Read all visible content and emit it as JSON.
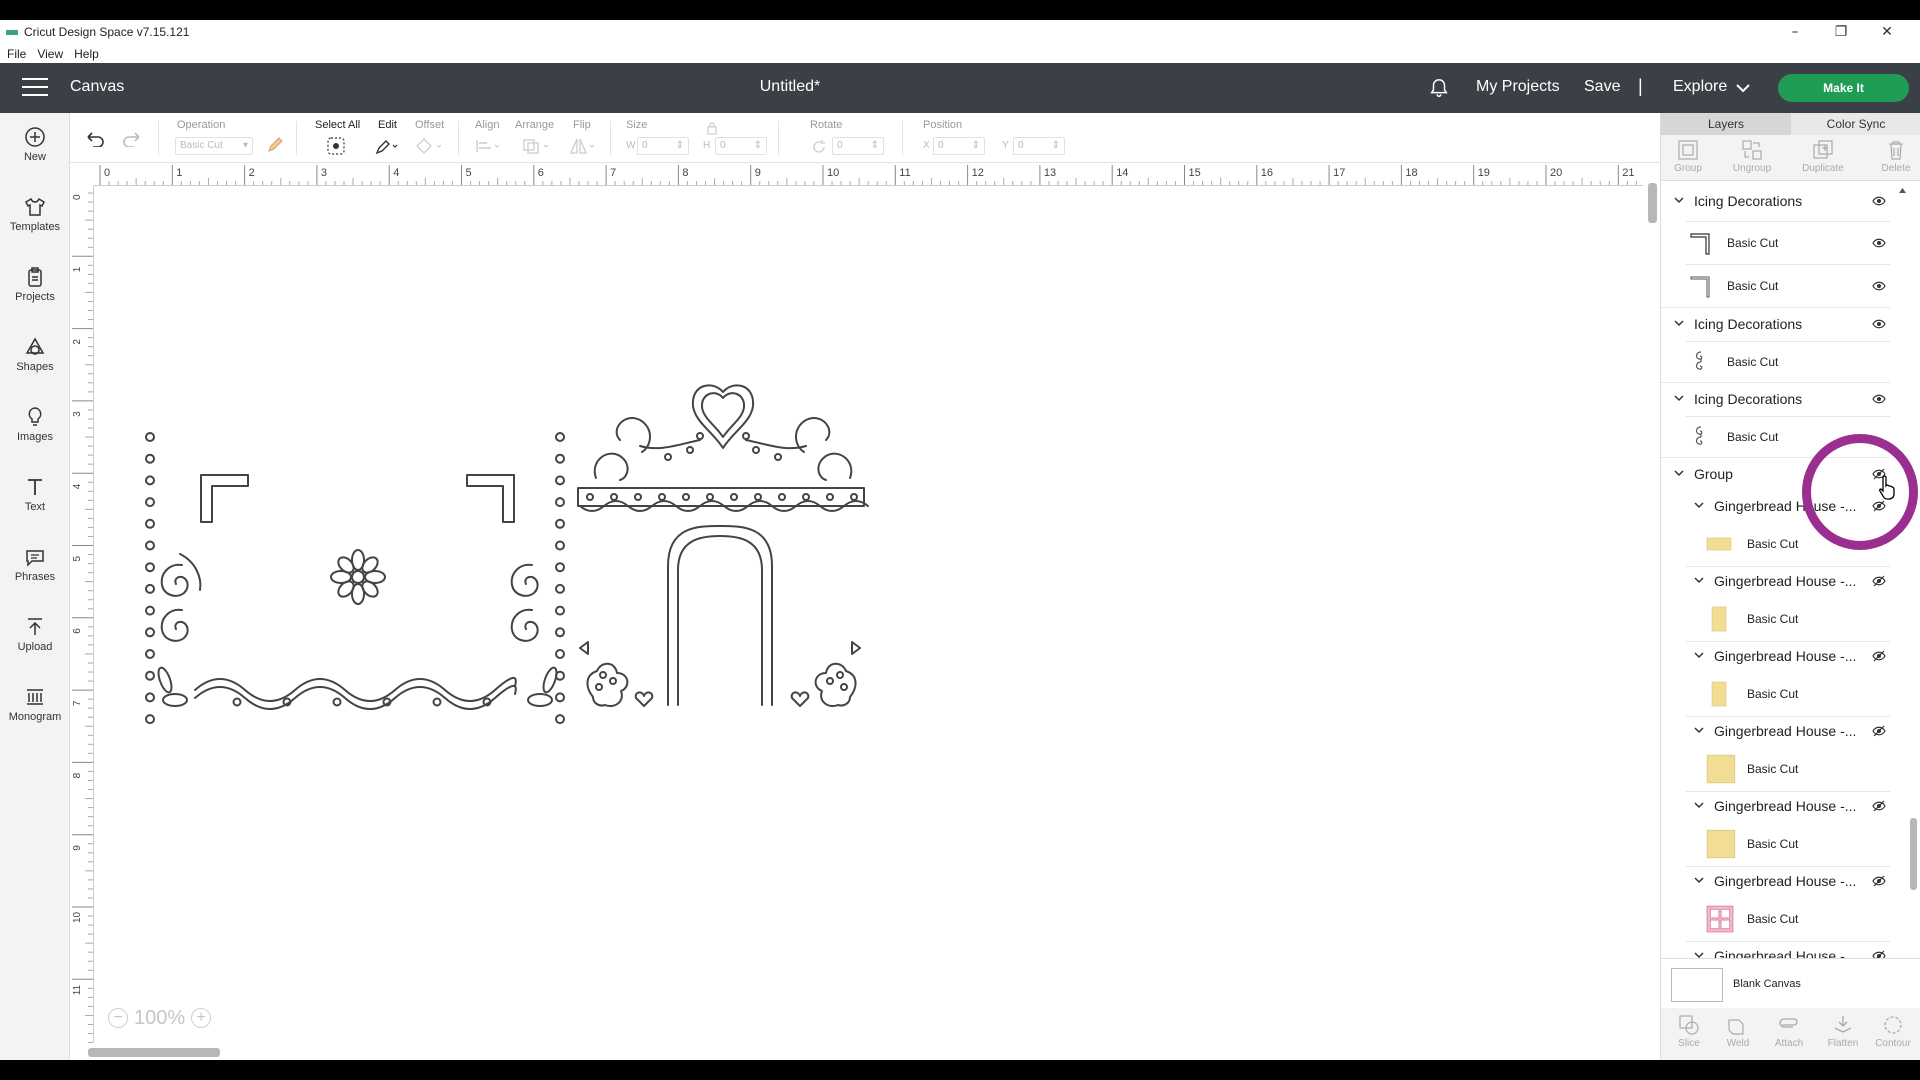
{
  "window": {
    "app_title": "Cricut Design Space  v7.15.121",
    "minimize": "–",
    "restore": "❐",
    "close": "✕"
  },
  "menu": [
    "File",
    "View",
    "Help"
  ],
  "header": {
    "canvas_label": "Canvas",
    "document_title": "Untitled*",
    "my_projects": "My Projects",
    "save": "Save",
    "separator": "|",
    "explore": "Explore",
    "make_it": "Make It",
    "make_it_color": "#1f9d55",
    "header_bg": "#3b4046"
  },
  "left_tools": [
    {
      "label": "New",
      "icon": "plus-circle-icon"
    },
    {
      "label": "Templates",
      "icon": "shirt-icon"
    },
    {
      "label": "Projects",
      "icon": "clipboard-icon"
    },
    {
      "label": "Shapes",
      "icon": "shapes-icon"
    },
    {
      "label": "Images",
      "icon": "lightbulb-icon"
    },
    {
      "label": "Text",
      "icon": "text-icon"
    },
    {
      "label": "Phrases",
      "icon": "speech-bubble-icon"
    },
    {
      "label": "Upload",
      "icon": "upload-icon"
    },
    {
      "label": "Monogram",
      "icon": "monogram-icon"
    }
  ],
  "edit_toolbar": {
    "operation_label": "Operation",
    "operation_value": "Basic Cut",
    "select_all": "Select All",
    "edit": "Edit",
    "offset": "Offset",
    "align": "Align",
    "arrange": "Arrange",
    "flip": "Flip",
    "size": "Size",
    "w_label": "W",
    "w_value": "0",
    "h_label": "H",
    "h_value": "0",
    "rotate": "Rotate",
    "rotate_value": "0",
    "position": "Position",
    "x_label": "X",
    "x_value": "0",
    "y_label": "Y",
    "y_value": "0"
  },
  "ruler": {
    "h_ticks": [
      "0",
      "1",
      "2",
      "3",
      "4",
      "5",
      "6",
      "7",
      "8",
      "9",
      "10",
      "11",
      "12",
      "13",
      "14",
      "15",
      "16",
      "17",
      "18",
      "19",
      "20",
      "21"
    ],
    "v_ticks": [
      "0",
      "1",
      "2",
      "3",
      "4",
      "5",
      "6",
      "7",
      "8",
      "9",
      "10",
      "11"
    ]
  },
  "zoom": {
    "minus": "−",
    "value": "100%",
    "plus": "+"
  },
  "right_panel": {
    "tabs": [
      "Layers",
      "Color Sync"
    ],
    "actions": [
      "Group",
      "Ungroup",
      "Duplicate",
      "Delete"
    ],
    "layers": [
      {
        "kind": "group",
        "name": "Icing Decorations",
        "eye": "visible"
      },
      {
        "kind": "item",
        "name": "Basic Cut",
        "thumb": "corner",
        "eye": "visible"
      },
      {
        "kind": "item",
        "name": "Basic Cut",
        "thumb": "corner2",
        "eye": "visible"
      },
      {
        "kind": "group",
        "name": "Icing Decorations",
        "eye": "visible"
      },
      {
        "kind": "item",
        "name": "Basic Cut",
        "thumb": "swirl",
        "eye": "none"
      },
      {
        "kind": "group",
        "name": "Icing Decorations",
        "eye": "visible"
      },
      {
        "kind": "item",
        "name": "Basic Cut",
        "thumb": "swirl",
        "eye": "none"
      },
      {
        "kind": "group",
        "name": "Group",
        "eye": "hidden"
      },
      {
        "kind": "subgroup",
        "name": "Gingerbread House -...",
        "eye": "hidden"
      },
      {
        "kind": "subitem",
        "name": "Basic Cut",
        "thumb": "wide",
        "color": "#f2dd94"
      },
      {
        "kind": "subgroup",
        "name": "Gingerbread House -...",
        "eye": "hidden"
      },
      {
        "kind": "subitem",
        "name": "Basic Cut",
        "thumb": "tall",
        "color": "#f2dd94"
      },
      {
        "kind": "subgroup",
        "name": "Gingerbread House -...",
        "eye": "hidden"
      },
      {
        "kind": "subitem",
        "name": "Basic Cut",
        "thumb": "tall",
        "color": "#f2dd94"
      },
      {
        "kind": "subgroup",
        "name": "Gingerbread House -...",
        "eye": "hidden"
      },
      {
        "kind": "subitem",
        "name": "Basic Cut",
        "thumb": "square",
        "color": "#f2dd94"
      },
      {
        "kind": "subgroup",
        "name": "Gingerbread House -...",
        "eye": "hidden"
      },
      {
        "kind": "subitem",
        "name": "Basic Cut",
        "thumb": "square",
        "color": "#f2dd94"
      },
      {
        "kind": "subgroup",
        "name": "Gingerbread House -...",
        "eye": "hidden"
      },
      {
        "kind": "subitem",
        "name": "Basic Cut",
        "thumb": "windows",
        "color": "#f4b8cf"
      },
      {
        "kind": "subgroup",
        "name": "Gingerbread House -...",
        "eye": "hidden"
      }
    ],
    "blank_canvas": "Blank Canvas",
    "bottom_actions": [
      "Slice",
      "Weld",
      "Attach",
      "Flatten",
      "Contour"
    ]
  },
  "accent_colors": {
    "cursor_ring": "#9b2f8f",
    "sketch_stroke": "#444444"
  }
}
